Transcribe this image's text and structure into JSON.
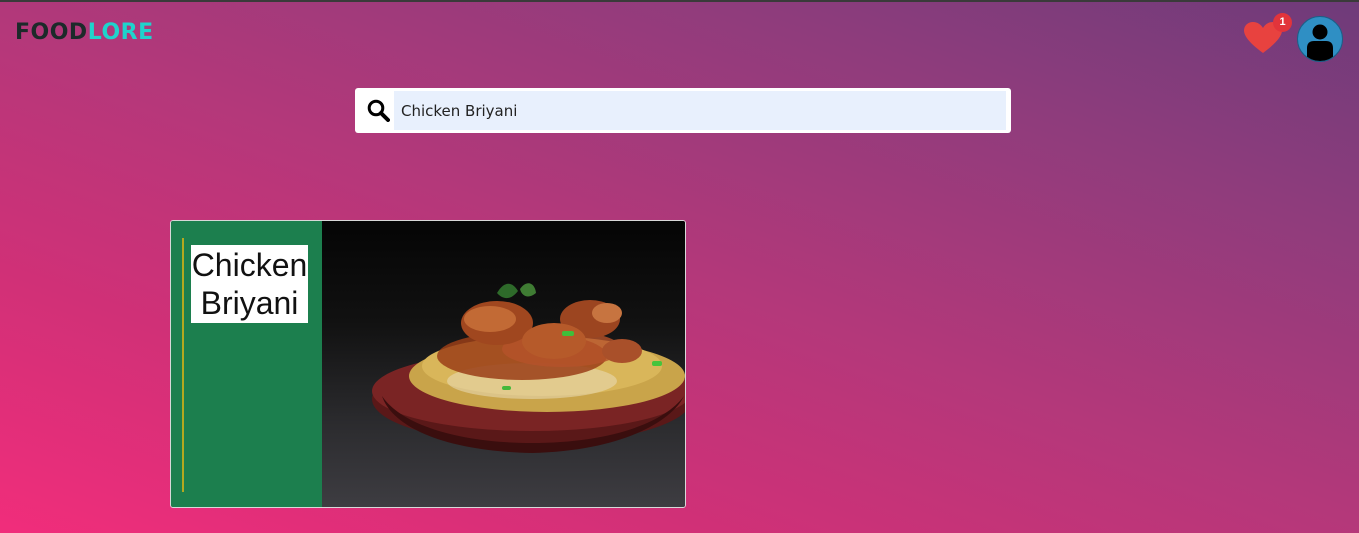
{
  "header": {
    "logo_part1": "FOOD",
    "logo_part2": "LORE",
    "favorites_count": "1",
    "favorites_icon": "heart-icon",
    "profile_icon": "user-icon"
  },
  "search": {
    "value": "Chicken Briyani",
    "icon": "search-icon"
  },
  "results": [
    {
      "title": "Chicken Briyani",
      "image": "chicken biryani plate photo",
      "menu_icon": "more-dots-icon"
    }
  ],
  "colors": {
    "brand_dark": "#1c2a2a",
    "brand_accent": "#1fd3cc",
    "card_side": "#1c7f4e",
    "badge": "#e2343b",
    "heart": "#e8423f",
    "dots": "#ffee00"
  }
}
